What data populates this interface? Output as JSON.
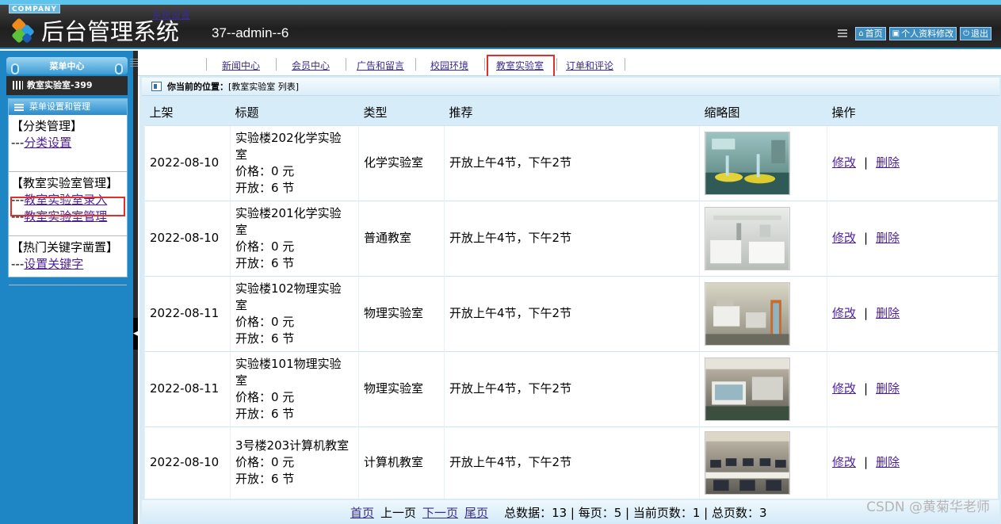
{
  "header": {
    "company": "COMPANY",
    "title": "后台管理系统",
    "user": "37--admin--6",
    "links": [
      {
        "icon": "home-icon",
        "label": "首页"
      },
      {
        "icon": "profile-icon",
        "label": "个人资料修改"
      },
      {
        "icon": "power-icon",
        "label": "退出"
      }
    ]
  },
  "sidebar": {
    "menu_center": "菜单中心",
    "current_module": "教室实验室-399",
    "panel_title": "菜单设置和管理",
    "groups": [
      {
        "title": "【分类管理】",
        "prefix": "---",
        "links": [
          "分类设置"
        ]
      },
      {
        "title": "【教室实验室管理】",
        "prefix": "---",
        "links": [
          "教室实验室录入",
          "教室实验室管理"
        ]
      },
      {
        "title": "【热门关键字凿置】",
        "prefix": "---",
        "links": [
          "设置关键字"
        ]
      }
    ]
  },
  "nav": {
    "items": [
      "系统设置",
      "新闻中心",
      "会员中心",
      "广告和留言",
      "校园环境",
      "教室实验室",
      "订单和评论"
    ],
    "active": "教室实验室"
  },
  "breadcrumb": {
    "label": "你当前的位置：",
    "value": "[教室实验室 列表]"
  },
  "table": {
    "columns": [
      "上架",
      "标题",
      "类型",
      "推荐",
      "缩略图",
      "操作"
    ],
    "rows": [
      {
        "date": "2022-08-10",
        "title": "实验楼202化学实验室",
        "price": "价格：0 元",
        "open": "开放：6 节",
        "type": "化学实验室",
        "recommend": "开放上午4节，下午2节",
        "thumb": "lab-bench-photo"
      },
      {
        "date": "2022-08-10",
        "title": "实验楼201化学实验室",
        "price": "价格：0 元",
        "open": "开放：6 节",
        "type": "普通教室",
        "recommend": "开放上午4节，下午2节",
        "thumb": "white-lab-photo"
      },
      {
        "date": "2022-08-11",
        "title": "实验楼102物理实验室",
        "price": "价格：0 元",
        "open": "开放：6 节",
        "type": "物理实验室",
        "recommend": "开放上午4节，下午2节",
        "thumb": "physics-equipment-photo"
      },
      {
        "date": "2022-08-11",
        "title": "实验楼101物理实验室",
        "price": "价格：0 元",
        "open": "开放：6 节",
        "type": "物理实验室",
        "recommend": "开放上午4节，下午2节",
        "thumb": "physics-room-photo"
      },
      {
        "date": "2022-08-10",
        "title": "3号楼203计算机教室",
        "price": "价格：0 元",
        "open": "开放：6 节",
        "type": "计算机教室",
        "recommend": "开放上午4节，下午2节",
        "thumb": "computer-room-photo"
      }
    ],
    "op_edit": "修改",
    "op_sep": "|",
    "op_delete": "删除"
  },
  "pager": {
    "first": "首页",
    "prev": "上一页",
    "next": "下一页",
    "last": "尾页",
    "summary": "总数据：13 | 每页：5 | 当前页数：1 | 总页数：3"
  },
  "watermark": "CSDN @黄菊华老师",
  "colors": {
    "accent": "#1e86c4",
    "header_bg": "#2a2a2a",
    "highlight": "#e0302d",
    "link": "#4b1f9c"
  }
}
